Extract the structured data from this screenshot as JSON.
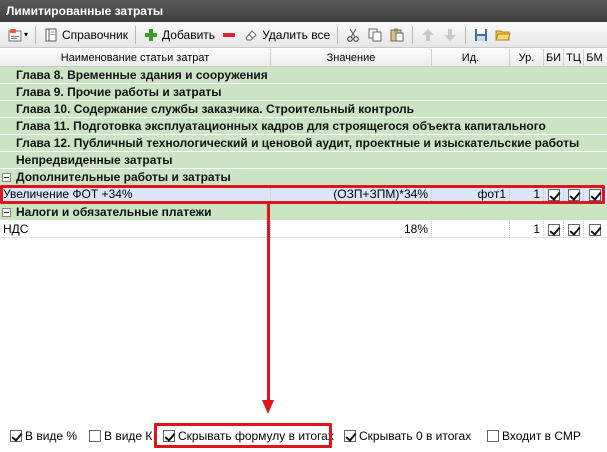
{
  "window": {
    "title": "Лимитированные затраты"
  },
  "toolbar": {
    "directory_label": "Справочник",
    "add_label": "Добавить",
    "delete_all_label": "Удалить все"
  },
  "columns": {
    "name": "Наименование статьи затрат",
    "value": "Значение",
    "id": "Ид.",
    "level": "Ур.",
    "bi": "БИ",
    "tc": "ТЦ",
    "bm": "БМ"
  },
  "groups": [
    "Глава 8. Временные здания и сооружения",
    "Глава 9. Прочие работы и затраты",
    "Глава 10. Содержание службы заказчика. Строительный контроль",
    "Глава 11. Подготовка эксплуатационных кадров для строящегося объекта капитального",
    "Глава 12. Публичный технологический и ценовой аудит, проектные и изыскательские работы",
    "Непредвиденные затраты"
  ],
  "section_additional": {
    "title": "Дополнительные работы и затраты",
    "row": {
      "name": "Увеличение ФОТ +34%",
      "value": "(ОЗП+ЗПМ)*34%",
      "id": "фот1",
      "level": "1",
      "bi": true,
      "tc": true,
      "bm": true
    }
  },
  "section_taxes": {
    "title": "Налоги и обязательные платежи",
    "row": {
      "name": "НДС",
      "value": "18%",
      "id": "",
      "level": "1",
      "bi": true,
      "tc": true,
      "bm": true
    }
  },
  "footer": {
    "as_percent": {
      "label": "В виде %",
      "checked": true
    },
    "as_k": {
      "label": "В виде К",
      "checked": false
    },
    "hide_formula": {
      "label": "Скрывать формулу в итогах",
      "checked": true
    },
    "hide_zero": {
      "label": "Скрывать 0 в итогах",
      "checked": true
    },
    "in_smr": {
      "label": "Входит в СМР",
      "checked": false
    }
  },
  "colors": {
    "highlight": "#e0151b",
    "group_bg": "#cbe4c4",
    "selected_bg": "#d9e6f8"
  }
}
